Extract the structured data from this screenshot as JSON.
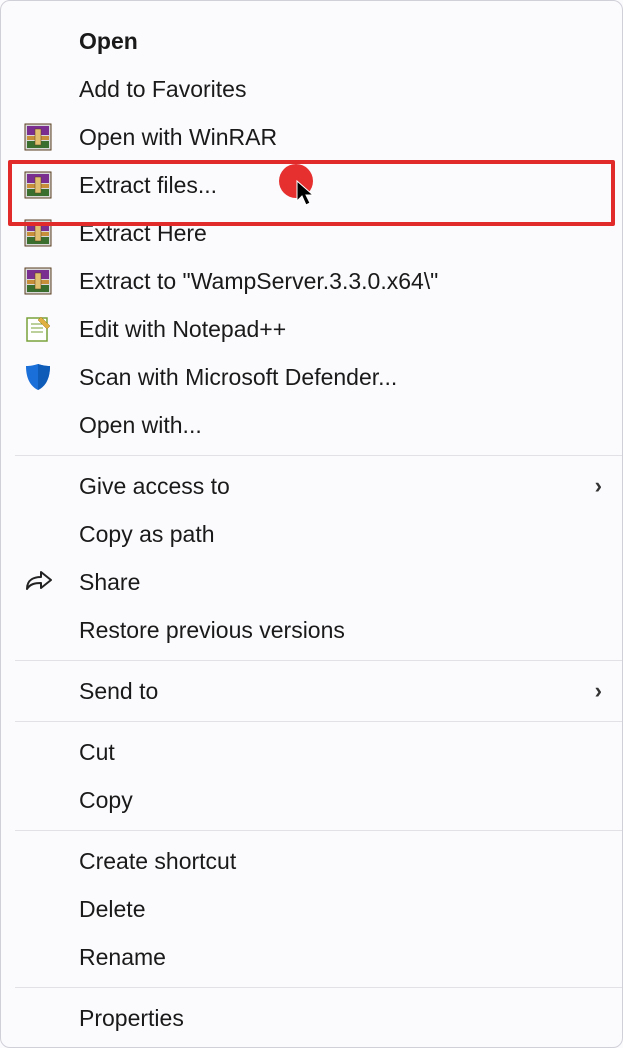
{
  "menu": {
    "open": "Open",
    "add_favorites": "Add to Favorites",
    "open_winrar": "Open with WinRAR",
    "extract_files": "Extract files...",
    "extract_here": "Extract Here",
    "extract_to": "Extract to \"WampServer.3.3.0.x64\\\"",
    "edit_notepad": "Edit with Notepad++",
    "scan_defender": "Scan with Microsoft Defender...",
    "open_with": "Open with...",
    "give_access": "Give access to",
    "copy_path": "Copy as path",
    "share": "Share",
    "restore": "Restore previous versions",
    "send_to": "Send to",
    "cut": "Cut",
    "copy": "Copy",
    "create_shortcut": "Create shortcut",
    "delete": "Delete",
    "rename": "Rename",
    "properties": "Properties"
  }
}
